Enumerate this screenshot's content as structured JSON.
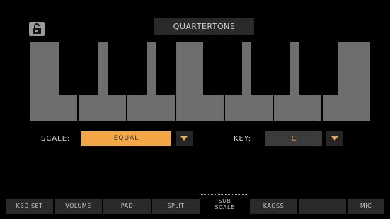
{
  "header": {
    "title": "QUARTERTONE",
    "lock_icon": "lock-icon"
  },
  "controls": {
    "scale_label": "SCALE:",
    "scale_value": "EQUAL",
    "key_label": "KEY:",
    "key_value": "C"
  },
  "colors": {
    "accent": "#f2a646",
    "white_key": "#6e6e6e",
    "tab_bg": "#2a2a2a"
  },
  "tabs": [
    {
      "label": "KBD SET"
    },
    {
      "label": "VOLUME"
    },
    {
      "label": "PAD"
    },
    {
      "label": "SPLIT"
    },
    {
      "label": "SUB\nSCALE",
      "active": true
    },
    {
      "label": "KAOSS"
    },
    {
      "label": ""
    },
    {
      "label": "MIC"
    }
  ]
}
